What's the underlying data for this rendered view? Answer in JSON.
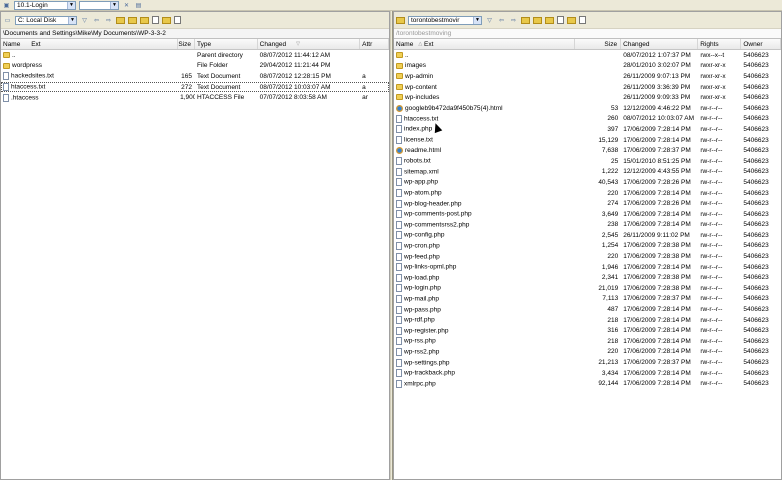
{
  "topbar": {
    "site_combo": "10.1-Login"
  },
  "left": {
    "drive_combo": "C: Local Disk",
    "path": "\\Documents and Settings\\Mike\\My Documents\\WP-3-3-2",
    "columns": {
      "name": "Name",
      "ext": "Ext",
      "size": "Size",
      "type": "Type",
      "changed": "Changed",
      "attr": "Attr"
    },
    "rows": [
      {
        "name": "..",
        "size": "",
        "type": "Parent directory",
        "changed": "08/07/2012 11:44:12 AM",
        "attr": "",
        "icon": "parent-folder-icon"
      },
      {
        "name": "wordpress",
        "size": "",
        "type": "File Folder",
        "changed": "29/04/2012 11:21:44 PM",
        "attr": "",
        "icon": "folder-icon"
      },
      {
        "name": "hackedsites.txt",
        "size": "165",
        "type": "Text Document",
        "changed": "08/07/2012 12:28:15 PM",
        "attr": "a",
        "icon": "file-icon"
      },
      {
        "name": "htaccess.txt",
        "size": "272",
        "type": "Text Document",
        "changed": "08/07/2012 10:03:07 AM",
        "attr": "a",
        "icon": "file-icon"
      },
      {
        "name": ".htaccess",
        "size": "1,900",
        "type": "HTACCESS File",
        "changed": "07/07/2012 8:03:58 AM",
        "attr": "ar",
        "icon": "file-icon"
      }
    ]
  },
  "right": {
    "dir_combo": "torontobestmovir",
    "path": "/torontobestmoving",
    "columns": {
      "name": "Name",
      "ext": "Ext",
      "size": "Size",
      "changed": "Changed",
      "rights": "Rights",
      "owner": "Owner"
    },
    "rows": [
      {
        "name": "..",
        "size": "",
        "changed": "08/07/2012 1:07:37 PM",
        "rights": "rwx--x--t",
        "owner": "5406623",
        "icon": "parent-folder-icon"
      },
      {
        "name": "images",
        "size": "",
        "changed": "28/01/2010 3:02:07 PM",
        "rights": "rwxr-xr-x",
        "owner": "5406623",
        "icon": "folder-icon"
      },
      {
        "name": "wp-admin",
        "size": "",
        "changed": "26/11/2009 9:07:13 PM",
        "rights": "rwxr-xr-x",
        "owner": "5406623",
        "icon": "folder-icon"
      },
      {
        "name": "wp-content",
        "size": "",
        "changed": "26/11/2009 3:36:39 PM",
        "rights": "rwxr-xr-x",
        "owner": "5406623",
        "icon": "folder-icon"
      },
      {
        "name": "wp-includes",
        "size": "",
        "changed": "26/11/2009 9:09:33 PM",
        "rights": "rwxr-xr-x",
        "owner": "5406623",
        "icon": "folder-icon"
      },
      {
        "name": "googleb9b472da9f450b75(4).html",
        "size": "53",
        "changed": "12/12/2009 4:46:22 PM",
        "rights": "rw-r--r--",
        "owner": "5406623",
        "icon": "html-icon"
      },
      {
        "name": "htaccess.txt",
        "size": "260",
        "changed": "08/07/2012 10:03:07 AM",
        "rights": "rw-r--r--",
        "owner": "5406623",
        "icon": "file-icon"
      },
      {
        "name": "index.php",
        "size": "397",
        "changed": "17/06/2009 7:28:14 PM",
        "rights": "rw-r--r--",
        "owner": "5406623",
        "icon": "file-icon"
      },
      {
        "name": "license.txt",
        "size": "15,129",
        "changed": "17/06/2009 7:28:14 PM",
        "rights": "rw-r--r--",
        "owner": "5406623",
        "icon": "file-icon"
      },
      {
        "name": "readme.html",
        "size": "7,638",
        "changed": "17/06/2009 7:28:37 PM",
        "rights": "rw-r--r--",
        "owner": "5406623",
        "icon": "html-icon"
      },
      {
        "name": "robots.txt",
        "size": "25",
        "changed": "15/01/2010 8:51:25 PM",
        "rights": "rw-r--r--",
        "owner": "5406623",
        "icon": "file-icon"
      },
      {
        "name": "sitemap.xml",
        "size": "1,222",
        "changed": "12/12/2009 4:43:55 PM",
        "rights": "rw-r--r--",
        "owner": "5406623",
        "icon": "file-icon"
      },
      {
        "name": "wp-app.php",
        "size": "40,543",
        "changed": "17/06/2009 7:28:26 PM",
        "rights": "rw-r--r--",
        "owner": "5406623",
        "icon": "file-icon"
      },
      {
        "name": "wp-atom.php",
        "size": "220",
        "changed": "17/06/2009 7:28:14 PM",
        "rights": "rw-r--r--",
        "owner": "5406623",
        "icon": "file-icon"
      },
      {
        "name": "wp-blog-header.php",
        "size": "274",
        "changed": "17/06/2009 7:28:26 PM",
        "rights": "rw-r--r--",
        "owner": "5406623",
        "icon": "file-icon"
      },
      {
        "name": "wp-comments-post.php",
        "size": "3,649",
        "changed": "17/06/2009 7:28:14 PM",
        "rights": "rw-r--r--",
        "owner": "5406623",
        "icon": "file-icon"
      },
      {
        "name": "wp-commentsrss2.php",
        "size": "238",
        "changed": "17/06/2009 7:28:14 PM",
        "rights": "rw-r--r--",
        "owner": "5406623",
        "icon": "file-icon"
      },
      {
        "name": "wp-config.php",
        "size": "2,545",
        "changed": "26/11/2009 9:11:02 PM",
        "rights": "rw-r--r--",
        "owner": "5406623",
        "icon": "file-icon"
      },
      {
        "name": "wp-cron.php",
        "size": "1,254",
        "changed": "17/06/2009 7:28:38 PM",
        "rights": "rw-r--r--",
        "owner": "5406623",
        "icon": "file-icon"
      },
      {
        "name": "wp-feed.php",
        "size": "220",
        "changed": "17/06/2009 7:28:38 PM",
        "rights": "rw-r--r--",
        "owner": "5406623",
        "icon": "file-icon"
      },
      {
        "name": "wp-links-opml.php",
        "size": "1,946",
        "changed": "17/06/2009 7:28:14 PM",
        "rights": "rw-r--r--",
        "owner": "5406623",
        "icon": "file-icon"
      },
      {
        "name": "wp-load.php",
        "size": "2,341",
        "changed": "17/06/2009 7:28:38 PM",
        "rights": "rw-r--r--",
        "owner": "5406623",
        "icon": "file-icon"
      },
      {
        "name": "wp-login.php",
        "size": "21,019",
        "changed": "17/06/2009 7:28:38 PM",
        "rights": "rw-r--r--",
        "owner": "5406623",
        "icon": "file-icon"
      },
      {
        "name": "wp-mail.php",
        "size": "7,113",
        "changed": "17/06/2009 7:28:37 PM",
        "rights": "rw-r--r--",
        "owner": "5406623",
        "icon": "file-icon"
      },
      {
        "name": "wp-pass.php",
        "size": "487",
        "changed": "17/06/2009 7:28:14 PM",
        "rights": "rw-r--r--",
        "owner": "5406623",
        "icon": "file-icon"
      },
      {
        "name": "wp-rdf.php",
        "size": "218",
        "changed": "17/06/2009 7:28:14 PM",
        "rights": "rw-r--r--",
        "owner": "5406623",
        "icon": "file-icon"
      },
      {
        "name": "wp-register.php",
        "size": "316",
        "changed": "17/06/2009 7:28:14 PM",
        "rights": "rw-r--r--",
        "owner": "5406623",
        "icon": "file-icon"
      },
      {
        "name": "wp-rss.php",
        "size": "218",
        "changed": "17/06/2009 7:28:14 PM",
        "rights": "rw-r--r--",
        "owner": "5406623",
        "icon": "file-icon"
      },
      {
        "name": "wp-rss2.php",
        "size": "220",
        "changed": "17/06/2009 7:28:14 PM",
        "rights": "rw-r--r--",
        "owner": "5406623",
        "icon": "file-icon"
      },
      {
        "name": "wp-settings.php",
        "size": "21,213",
        "changed": "17/06/2009 7:28:37 PM",
        "rights": "rw-r--r--",
        "owner": "5406623",
        "icon": "file-icon"
      },
      {
        "name": "wp-trackback.php",
        "size": "3,434",
        "changed": "17/06/2009 7:28:14 PM",
        "rights": "rw-r--r--",
        "owner": "5406623",
        "icon": "file-icon"
      },
      {
        "name": "xmlrpc.php",
        "size": "92,144",
        "changed": "17/06/2009 7:28:14 PM",
        "rights": "rw-r--r--",
        "owner": "5406623",
        "icon": "file-icon"
      }
    ]
  }
}
